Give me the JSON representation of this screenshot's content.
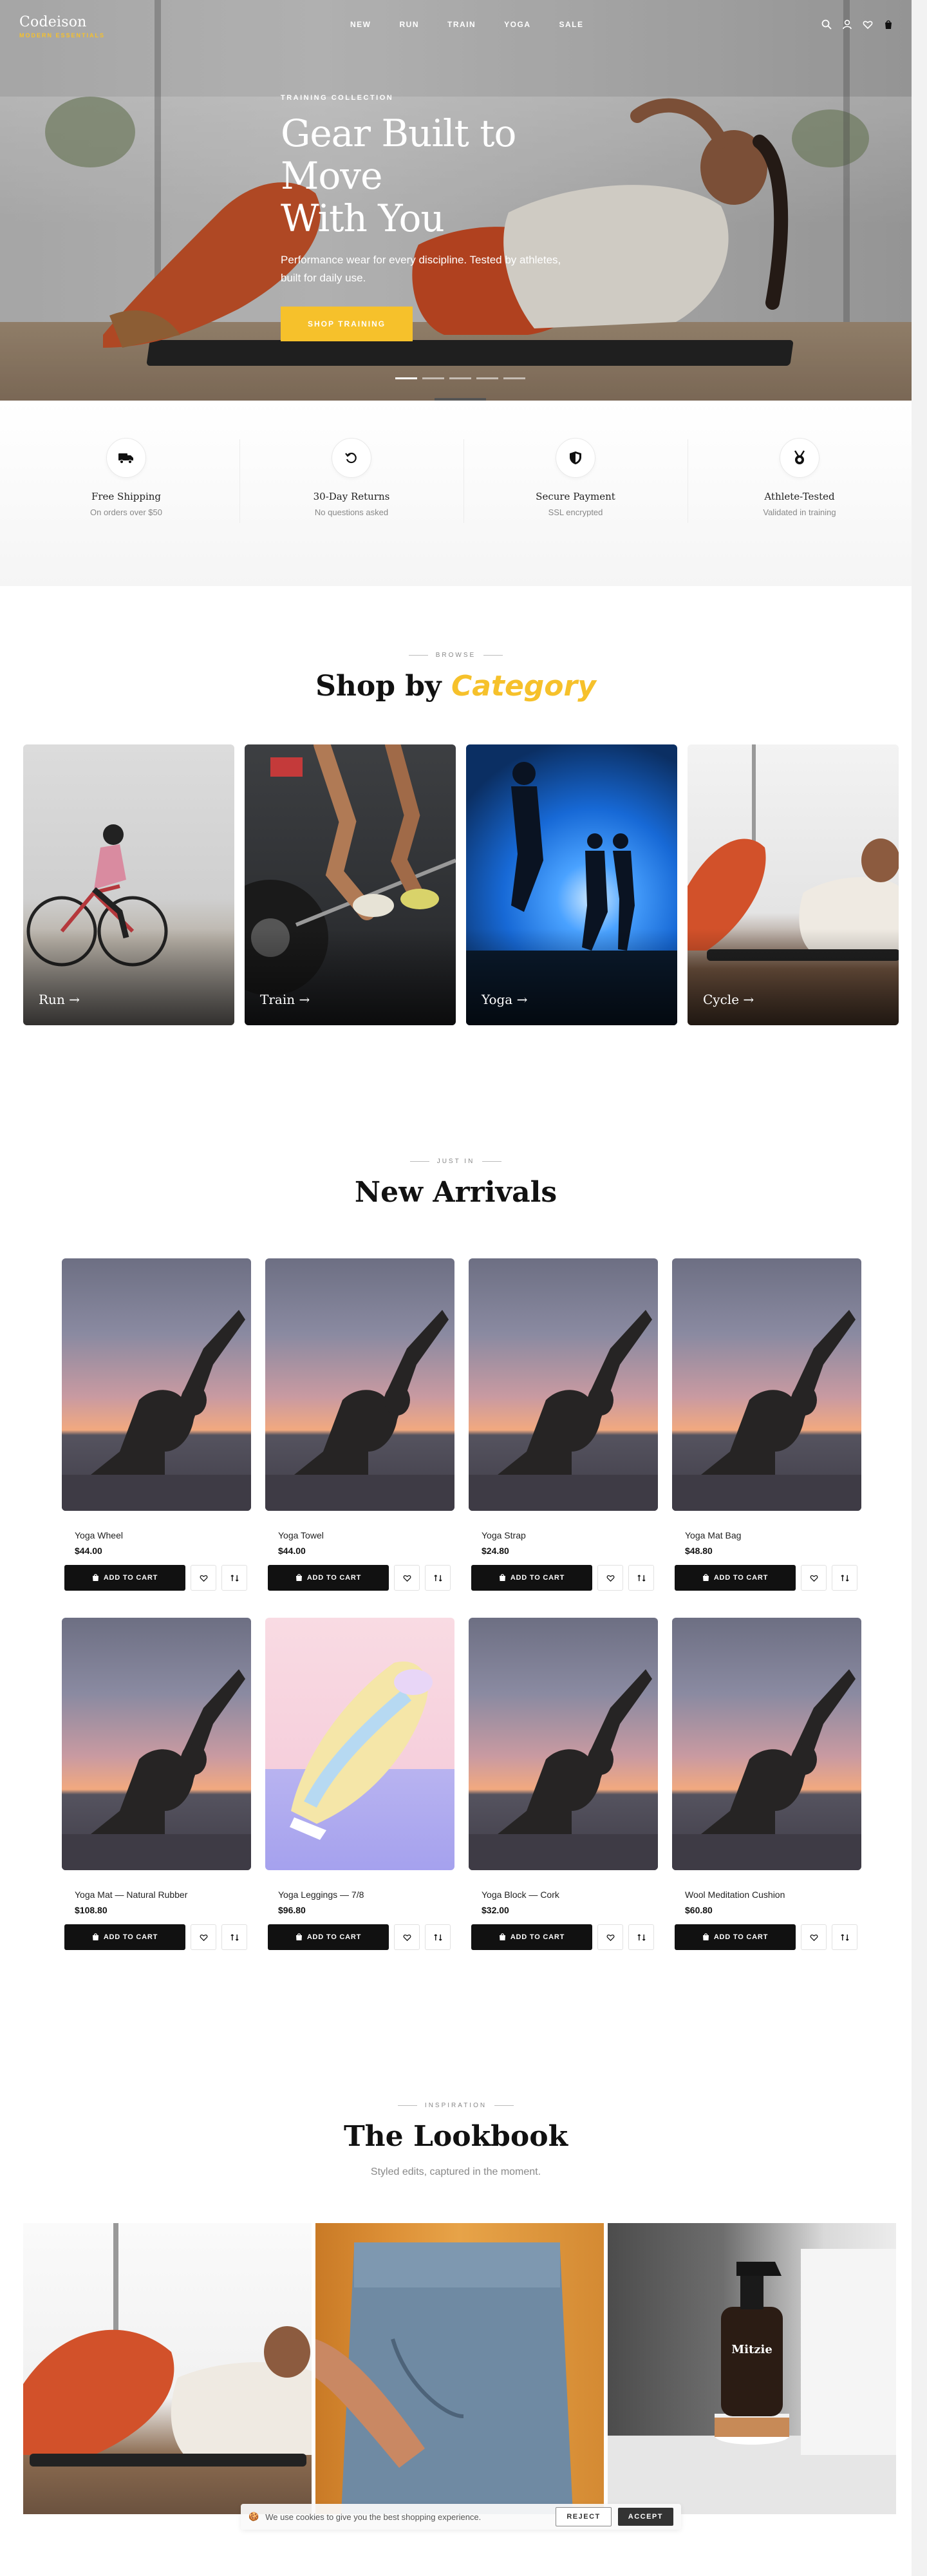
{
  "header": {
    "logo_name": "Codeison",
    "logo_tagline": "MODERN ESSENTIALS",
    "nav": [
      "NEW",
      "RUN",
      "TRAIN",
      "YOGA",
      "SALE"
    ],
    "icons": [
      "search-icon",
      "account-icon",
      "wishlist-icon",
      "cart-icon"
    ]
  },
  "hero": {
    "eyebrow": "TRAINING COLLECTION",
    "title_line1": "Gear Built to Move",
    "title_line2": "With You",
    "subtitle": "Performance wear for every discipline. Tested by athletes, built for daily use.",
    "cta": "SHOP TRAINING",
    "slides_count": 5,
    "active_slide": 1
  },
  "features": [
    {
      "icon": "truck-icon",
      "title": "Free Shipping",
      "subtitle": "On orders over $50"
    },
    {
      "icon": "return-icon",
      "title": "30-Day Returns",
      "subtitle": "No questions asked"
    },
    {
      "icon": "shield-icon",
      "title": "Secure Payment",
      "subtitle": "SSL encrypted"
    },
    {
      "icon": "medal-icon",
      "title": "Athlete-Tested",
      "subtitle": "Validated in training"
    }
  ],
  "categories": {
    "kicker": "BROWSE",
    "title_main": "Shop by",
    "title_accent": "Category",
    "items": [
      "Run →",
      "Train →",
      "Yoga →",
      "Cycle →"
    ]
  },
  "arrivals": {
    "kicker": "JUST IN",
    "title": "New Arrivals",
    "cart_label": "ADD TO CART",
    "products": [
      {
        "name": "Yoga Wheel",
        "price": "$44.00",
        "image": "yoga-pose"
      },
      {
        "name": "Yoga Towel",
        "price": "$44.00",
        "image": "yoga-pose"
      },
      {
        "name": "Yoga Strap",
        "price": "$24.80",
        "image": "yoga-pose"
      },
      {
        "name": "Yoga Mat Bag",
        "price": "$48.80",
        "image": "yoga-pose"
      },
      {
        "name": "Yoga Mat — Natural Rubber",
        "price": "$108.80",
        "image": "yoga-pose"
      },
      {
        "name": "Yoga Leggings — 7/8",
        "price": "$96.80",
        "image": "sneaker"
      },
      {
        "name": "Yoga Block — Cork",
        "price": "$32.00",
        "image": "yoga-pose"
      },
      {
        "name": "Wool Meditation Cushion",
        "price": "$60.80",
        "image": "yoga-pose"
      }
    ]
  },
  "lookbook": {
    "kicker": "INSPIRATION",
    "title": "The Lookbook",
    "subtitle": "Styled edits, captured in the moment.",
    "bottle_label": "Mitzie"
  },
  "cookie": {
    "text": "We use cookies to give you the best shopping experience.",
    "reject": "REJECT",
    "accept": "ACCEPT"
  },
  "colors": {
    "accent": "#f6c12b",
    "button_dark": "#111111"
  }
}
